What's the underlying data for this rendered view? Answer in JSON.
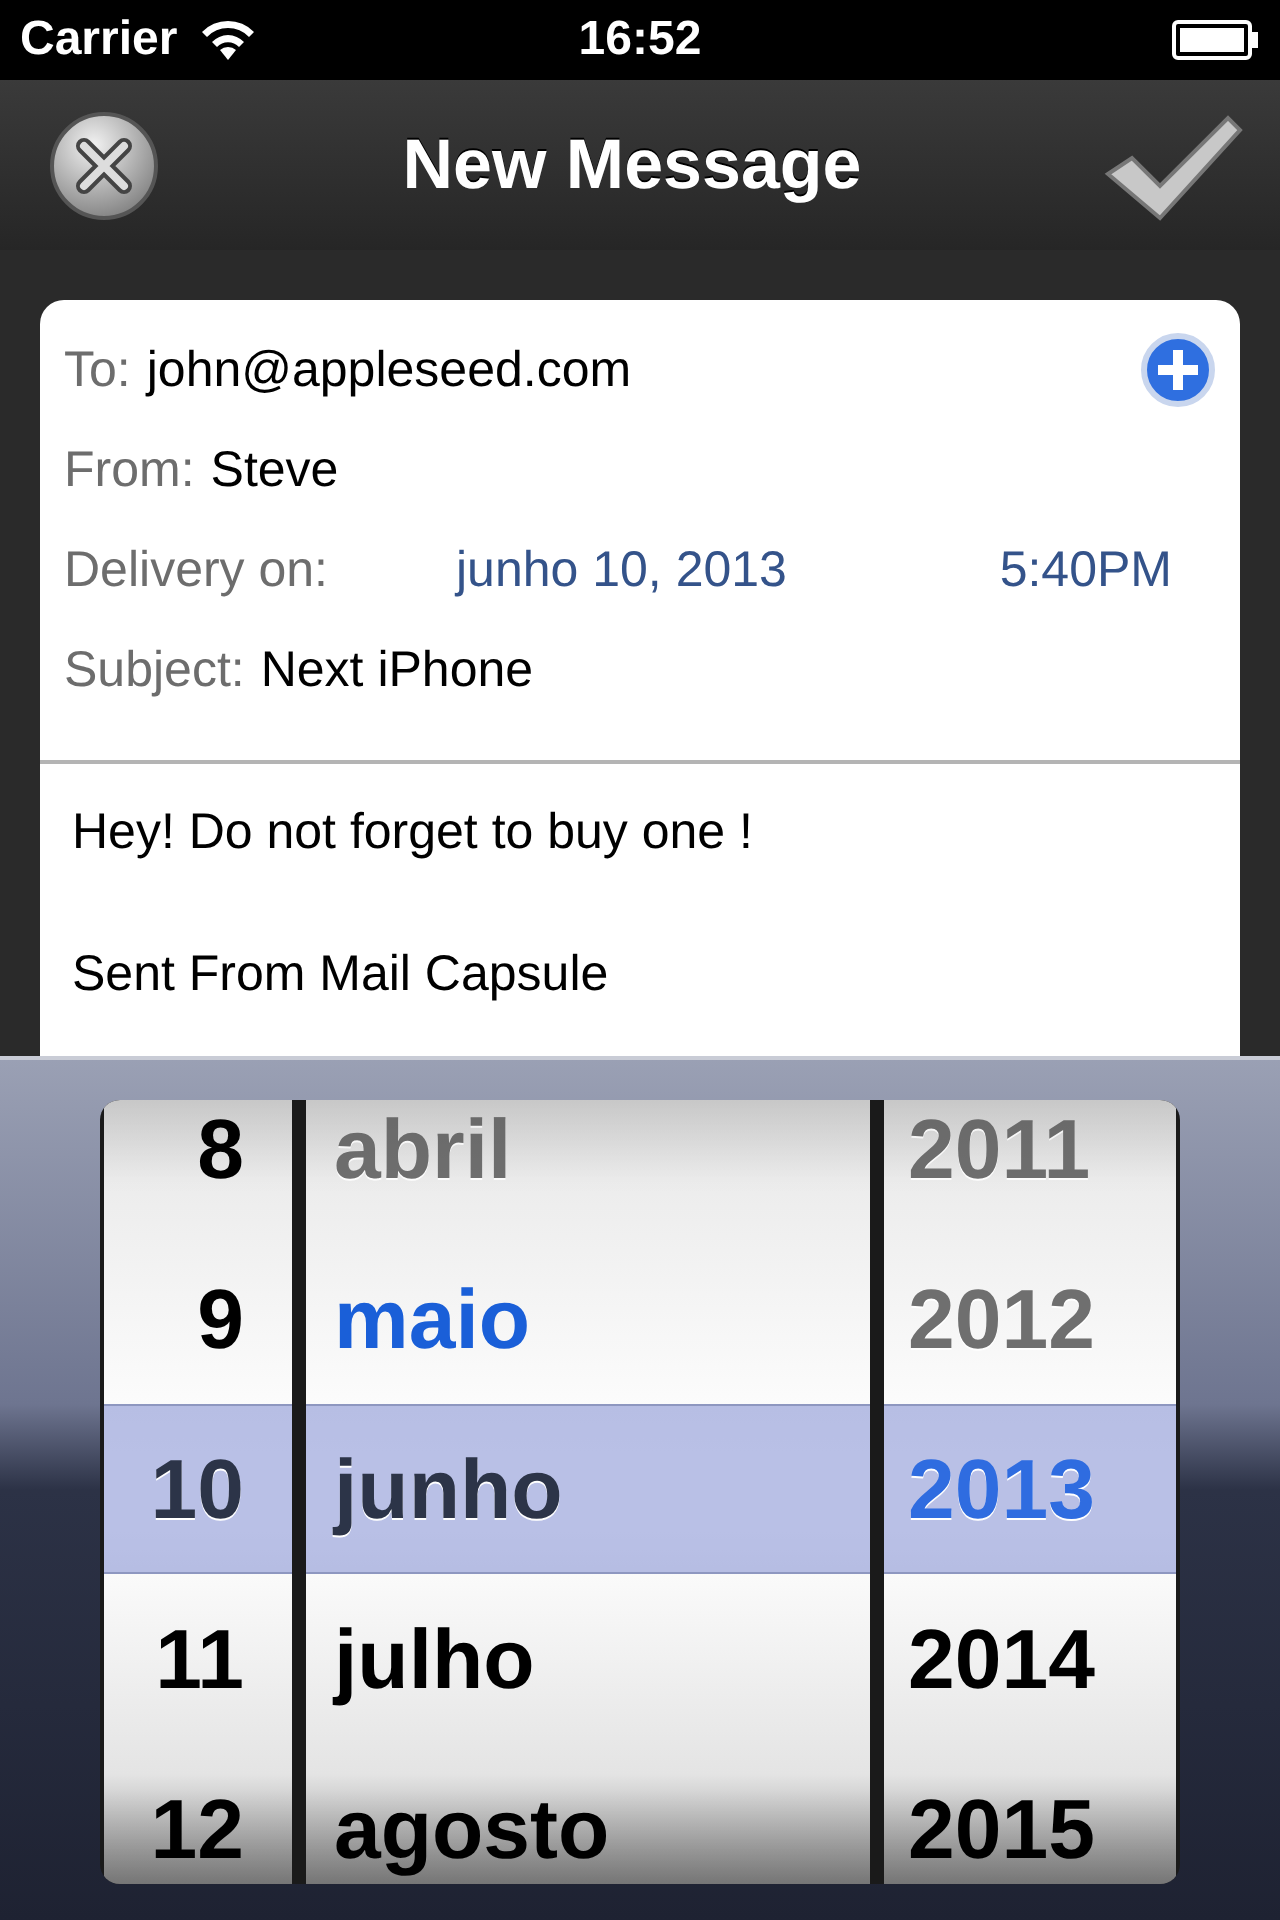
{
  "status_bar": {
    "carrier": "Carrier",
    "time": "16:52"
  },
  "nav_bar": {
    "title": "New Message"
  },
  "form": {
    "to_label": "To:",
    "to_value": "john@appleseed.com",
    "from_label": "From:",
    "from_value": "Steve",
    "delivery_label": "Delivery on:",
    "delivery_date": "junho 10, 2013",
    "delivery_time": "5:40PM",
    "subject_label": "Subject:",
    "subject_value": "Next iPhone"
  },
  "body": [
    "Hey! Do not forget to buy one !",
    "Sent From Mail Capsule"
  ],
  "picker": {
    "columns": [
      {
        "kind": "day",
        "items": [
          {
            "label": "8",
            "selected": false,
            "disabled": false,
            "current": false
          },
          {
            "label": "9",
            "selected": false,
            "disabled": false,
            "current": false
          },
          {
            "label": "10",
            "selected": true,
            "disabled": false,
            "current": false
          },
          {
            "label": "11",
            "selected": false,
            "disabled": false,
            "current": false
          },
          {
            "label": "12",
            "selected": false,
            "disabled": false,
            "current": false
          }
        ]
      },
      {
        "kind": "month",
        "items": [
          {
            "label": "abril",
            "selected": false,
            "disabled": true,
            "current": false
          },
          {
            "label": "maio",
            "selected": false,
            "disabled": false,
            "current": true
          },
          {
            "label": "junho",
            "selected": true,
            "disabled": false,
            "current": false
          },
          {
            "label": "julho",
            "selected": false,
            "disabled": false,
            "current": false
          },
          {
            "label": "agosto",
            "selected": false,
            "disabled": false,
            "current": false
          }
        ]
      },
      {
        "kind": "year",
        "items": [
          {
            "label": "2011",
            "selected": false,
            "disabled": true,
            "current": false
          },
          {
            "label": "2012",
            "selected": false,
            "disabled": true,
            "current": false
          },
          {
            "label": "2013",
            "selected": true,
            "disabled": false,
            "current": true
          },
          {
            "label": "2014",
            "selected": false,
            "disabled": false,
            "current": false
          },
          {
            "label": "2015",
            "selected": false,
            "disabled": false,
            "current": false
          }
        ]
      }
    ]
  }
}
